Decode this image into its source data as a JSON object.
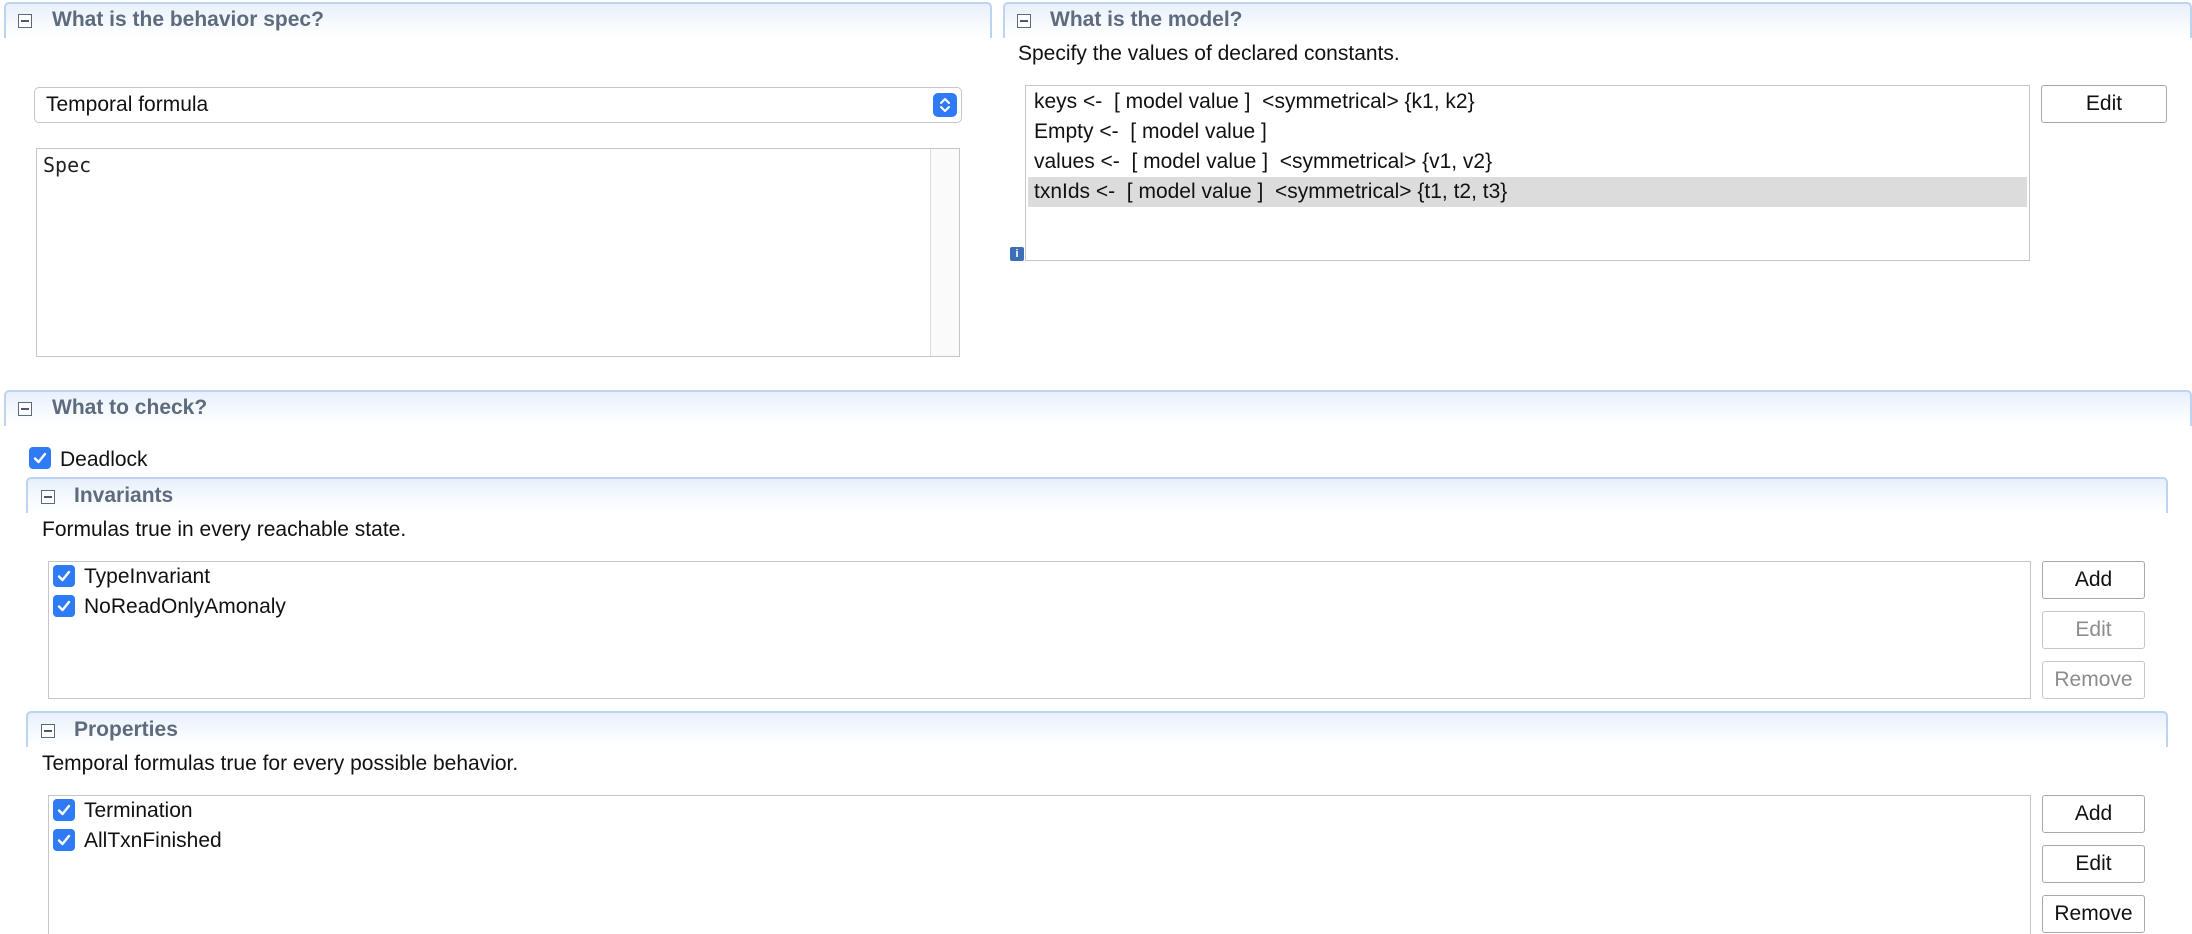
{
  "behavior": {
    "title": "What is the behavior spec?",
    "select_value": "Temporal formula",
    "spec_text": "Spec"
  },
  "model": {
    "title": "What is the model?",
    "description": "Specify the values of declared constants.",
    "constants": [
      {
        "text": "keys <-  [ model value ]  <symmetrical> {k1, k2}",
        "selected": false
      },
      {
        "text": "Empty <-  [ model value ]",
        "selected": false
      },
      {
        "text": "values <-  [ model value ]  <symmetrical> {v1, v2}",
        "selected": false
      },
      {
        "text": "txnIds <-  [ model value ]  <symmetrical> {t1, t2, t3}",
        "selected": true
      }
    ],
    "edit_label": "Edit",
    "info_icon": "i"
  },
  "check": {
    "title": "What to check?",
    "deadlock_label": "Deadlock",
    "deadlock_checked": true,
    "invariants": {
      "title": "Invariants",
      "description": "Formulas true in every reachable state.",
      "items": [
        {
          "label": "TypeInvariant",
          "checked": true
        },
        {
          "label": "NoReadOnlyAmonaly",
          "checked": true
        }
      ],
      "add_label": "Add",
      "edit_label": "Edit",
      "remove_label": "Remove"
    },
    "properties": {
      "title": "Properties",
      "description": "Temporal formulas true for every possible behavior.",
      "items": [
        {
          "label": "Termination",
          "checked": true
        },
        {
          "label": "AllTxnFinished",
          "checked": true
        }
      ],
      "add_label": "Add",
      "edit_label": "Edit",
      "remove_label": "Remove"
    }
  },
  "colors": {
    "accent": "#2f7bf5",
    "section_title": "#5d6b7c",
    "section_border": "#bcd4ef",
    "selected_row": "#dcdcdc"
  }
}
